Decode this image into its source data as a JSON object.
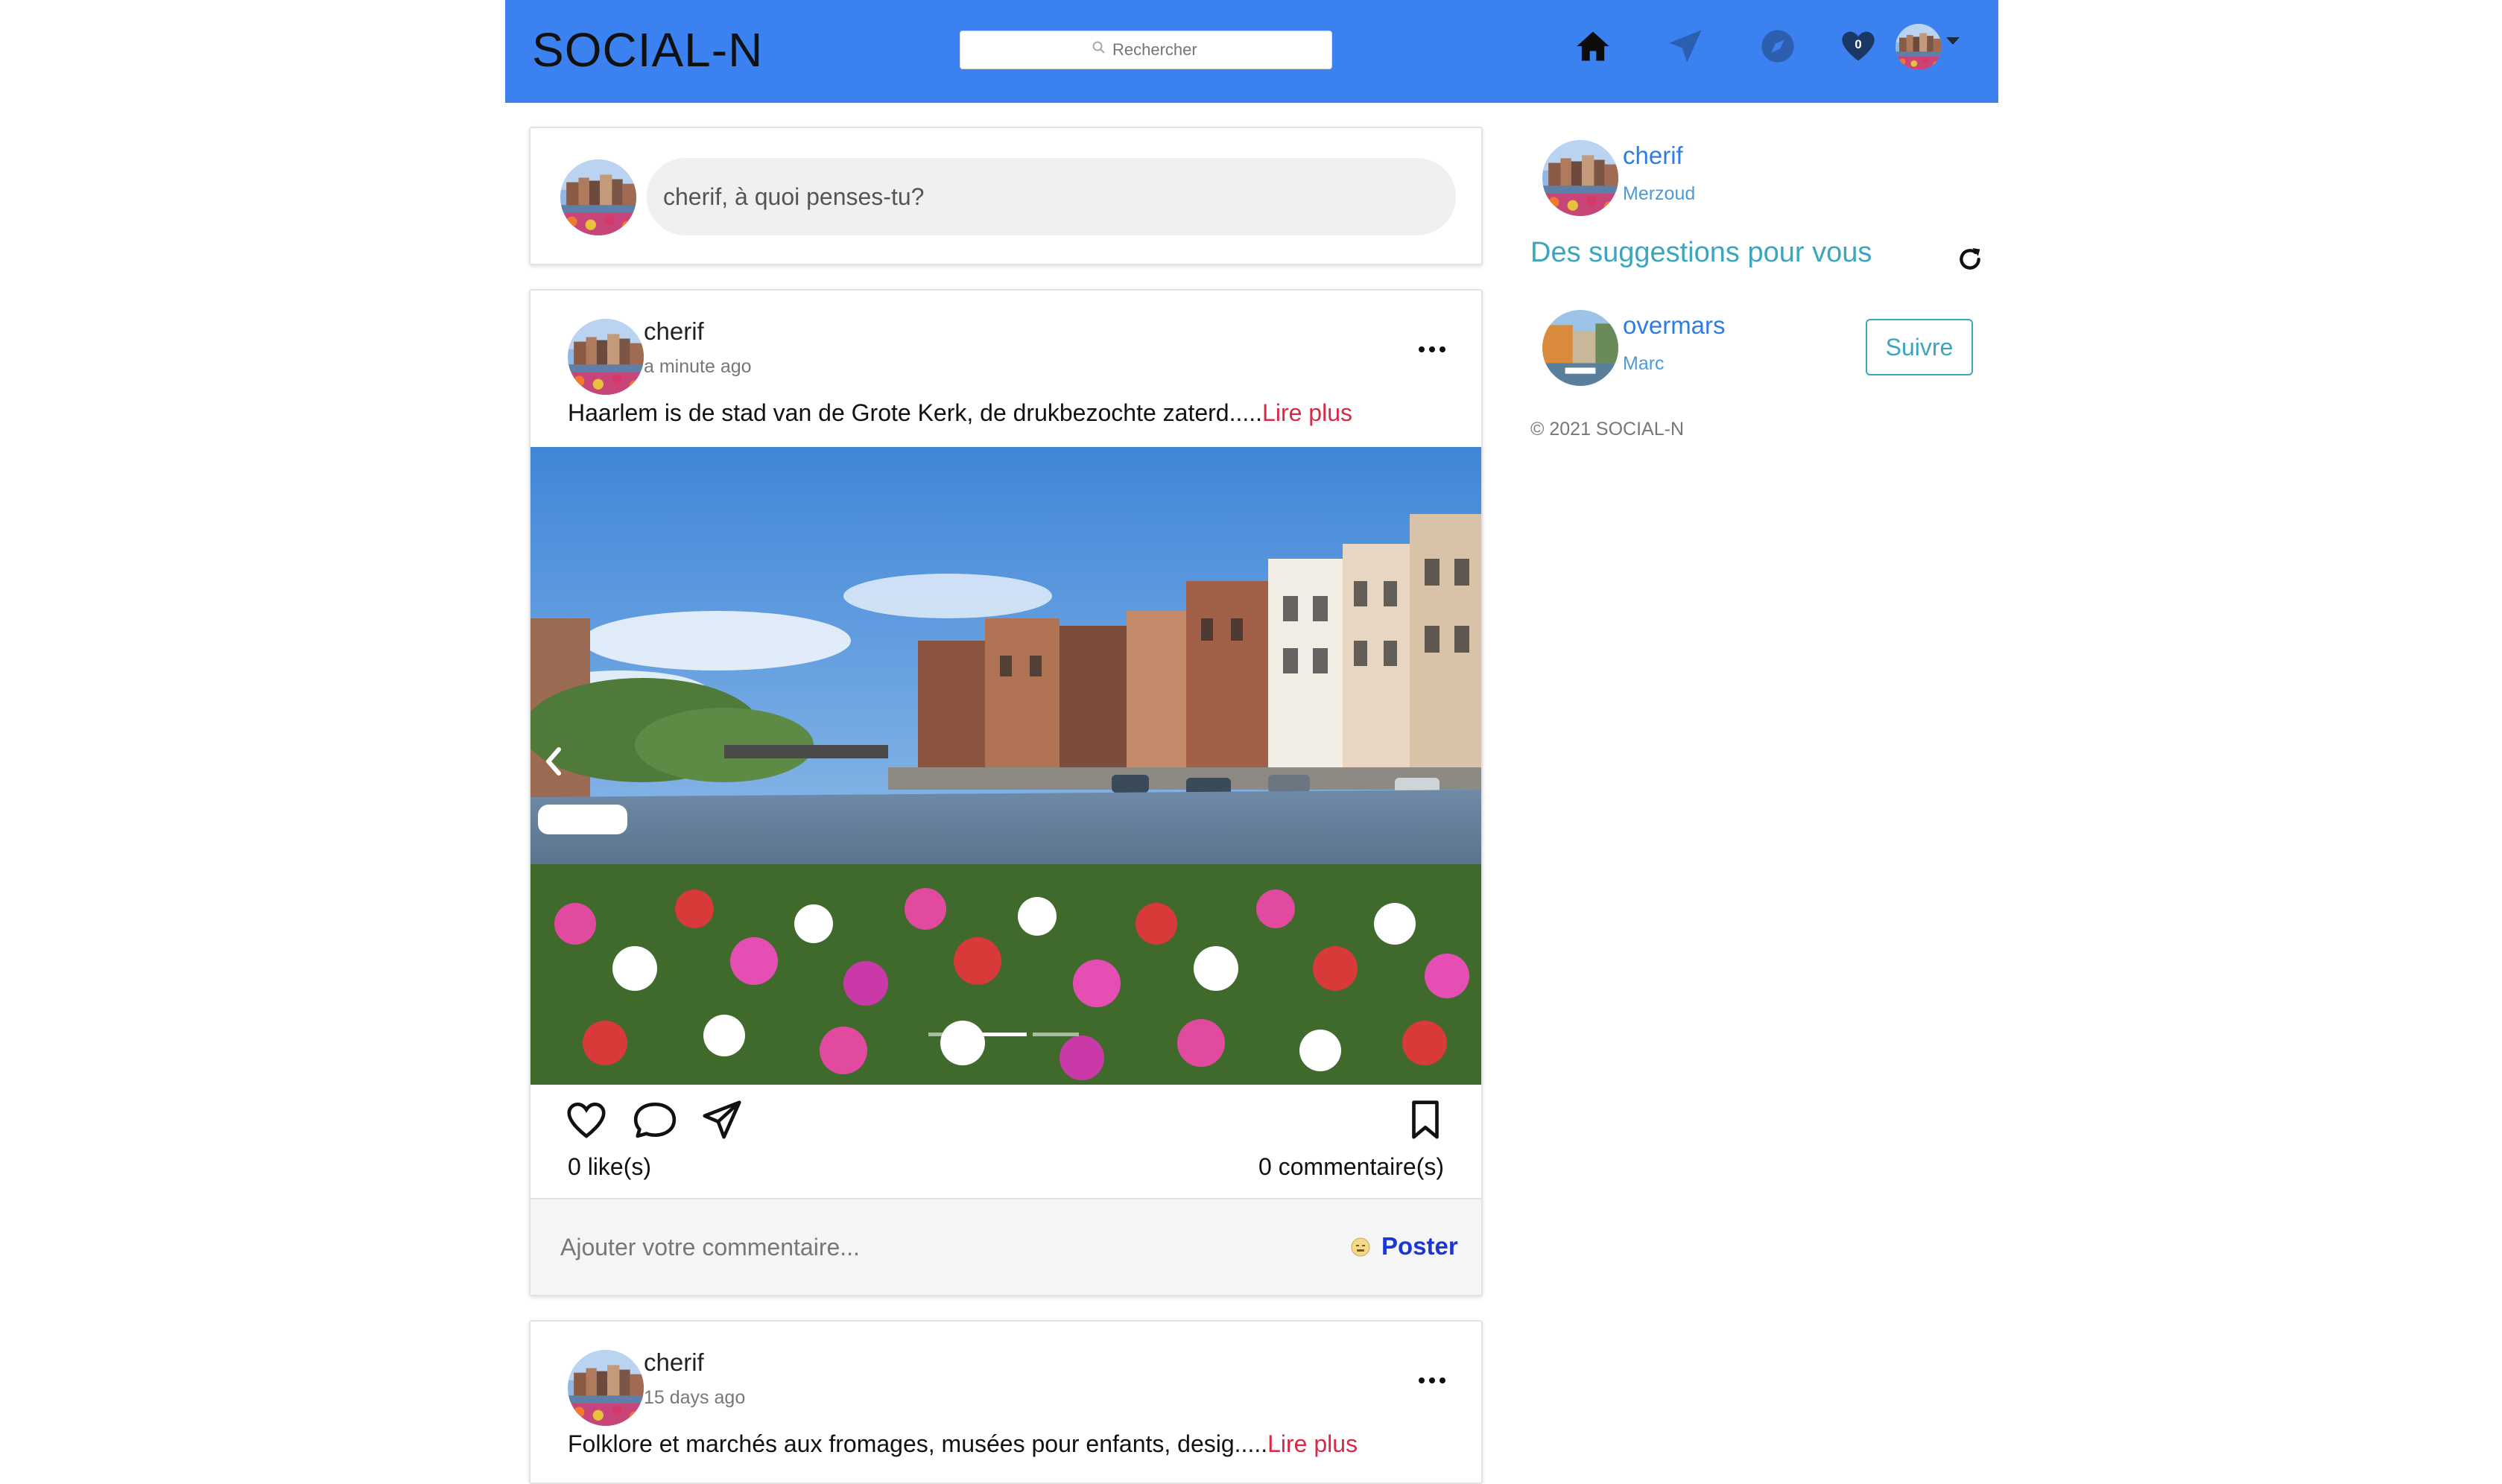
{
  "navbar": {
    "brand": "SOCIAL-N",
    "search_placeholder": "Rechercher",
    "notification_count": "0",
    "bg_color": "#3b82f0"
  },
  "composer": {
    "prompt": "cherif, à quoi penses-tu?"
  },
  "posts": [
    {
      "author": "cherif",
      "time": "a minute ago",
      "text": "Haarlem is de stad van de Grote Kerk, de drukbezochte zaterd.....",
      "read_more": "Lire plus",
      "likes": "0 like(s)",
      "comments": "0 commentaire(s)",
      "comment_placeholder": "Ajouter votre commentaire...",
      "post_button": "Poster",
      "image": "haarlem-canal-flowers",
      "carousel": {
        "slides": 3,
        "active": 2
      }
    },
    {
      "author": "cherif",
      "time": "15 days ago",
      "text": "Folklore et marchés aux fromages, musées pour enfants, desig.....",
      "read_more": "Lire plus"
    }
  ],
  "sidebar": {
    "profile": {
      "username": "cherif",
      "fullname": "Merzoud"
    },
    "suggestions_title": "Des suggestions pour vous",
    "suggestions": [
      {
        "username": "overmars",
        "fullname": "Marc",
        "follow_label": "Suivre"
      }
    ],
    "copyright": "© 2021 SOCIAL-N"
  },
  "icons": [
    "search-icon",
    "home-icon",
    "send-icon",
    "compass-icon",
    "heart-icon",
    "caret-down-icon",
    "more-icon",
    "chevron-left-icon",
    "like-icon",
    "comment-icon",
    "share-icon",
    "bookmark-icon",
    "emoji-icon",
    "refresh-icon"
  ],
  "colors": {
    "accent": "#3b82f0",
    "read_more": "#d62a45",
    "link": "#2f7de1",
    "teal": "#3ba6bd",
    "poster": "#1b36d6"
  }
}
